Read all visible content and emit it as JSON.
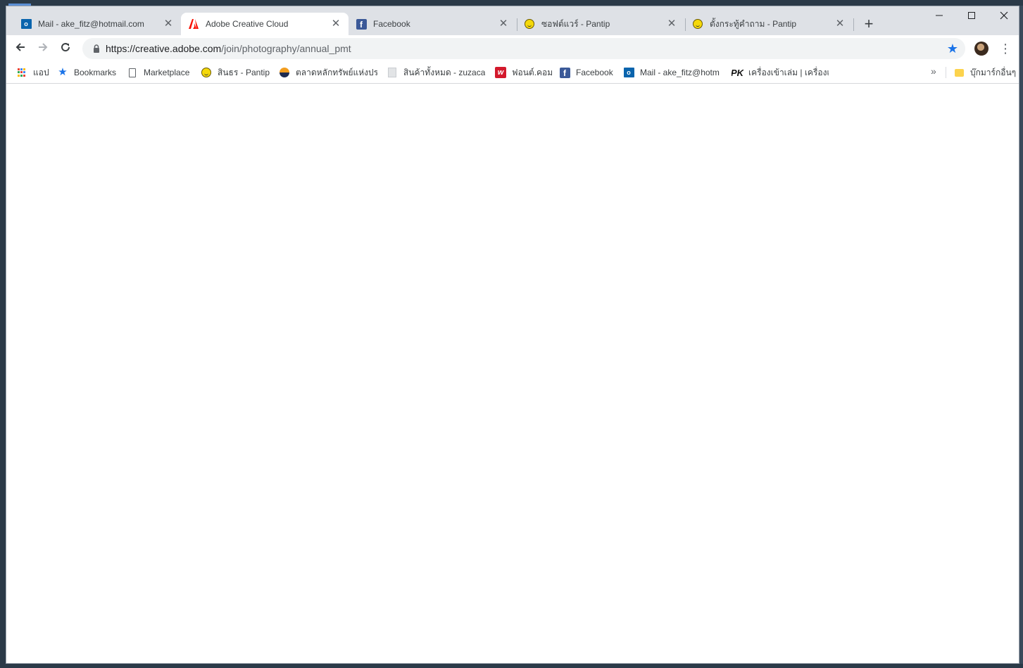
{
  "tabs": [
    {
      "title": "Mail - ake_fitz@hotmail.com",
      "icon": "outlook-icon",
      "active": false
    },
    {
      "title": "Adobe Creative Cloud",
      "icon": "adobe-icon",
      "active": true
    },
    {
      "title": "Facebook",
      "icon": "facebook-icon",
      "active": false
    },
    {
      "title": "ซอฟต์แวร์ - Pantip",
      "icon": "pantip-icon",
      "active": false
    },
    {
      "title": "ตั้งกระทู้คำถาม - Pantip",
      "icon": "pantip-icon",
      "active": false
    }
  ],
  "address_bar": {
    "host": "https://creative.adobe.com",
    "path": "/join/photography/annual_pmt"
  },
  "bookmarks": [
    {
      "label": "แอป",
      "icon": "apps-icon"
    },
    {
      "label": "Bookmarks",
      "icon": "star-icon"
    },
    {
      "label": "Marketplace",
      "icon": "page-icon"
    },
    {
      "label": "สินธร - Pantip",
      "icon": "pantip-icon"
    },
    {
      "label": "ตลาดหลักทรัพย์แห่งประเ",
      "icon": "set-icon"
    },
    {
      "label": "สินค้าทั้งหมด - zuzacar",
      "icon": "zuza-icon"
    },
    {
      "label": "ฟอนต์.คอม",
      "icon": "fontcom-icon"
    },
    {
      "label": "Facebook",
      "icon": "facebook-icon"
    },
    {
      "label": "Mail - ake_fitz@hotm",
      "icon": "outlook-icon"
    },
    {
      "label": "เครื่องเข้าเล่ม | เครื่องเคลื",
      "icon": "pk-icon"
    }
  ],
  "bookmarks_more": "»",
  "other_bookmarks": "บุ๊กมาร์กอื่นๆ",
  "colors": {
    "accent": "#1a73e8",
    "tabstrip": "#dee1e6",
    "adobe_red": "#fa0f00"
  }
}
